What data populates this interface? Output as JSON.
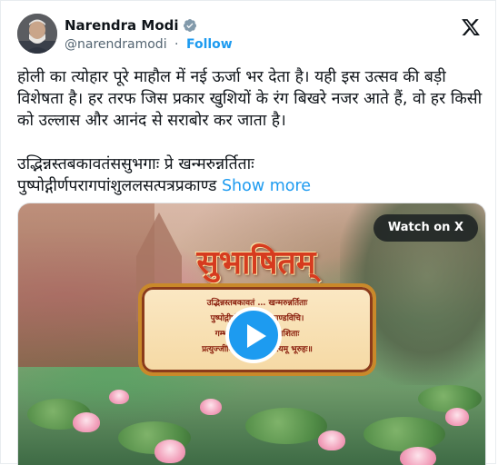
{
  "author": {
    "name": "Narendra Modi",
    "handle": "@narendramodi",
    "separator": "·",
    "follow_label": "Follow"
  },
  "tweet": {
    "text": "होली का त्योहार पूरे माहौल में नई ऊर्जा भर देता है। यही इस उत्सव की बड़ी विशेषता है। हर तरफ जिस प्रकार खुशियों के रंग बिखरे नजर आते हैं, वो हर किसी को उल्लास और आनंद से सराबोर कर जाता है।\n\nउद्भिन्नस्तबकावतंससुभगाः प्रे खन्मरुन्नर्तिताः\nपुष्पोद्गीर्णपरागपांशुललसत्पत्रप्रकाण्ड ",
    "show_more_label": "Show more"
  },
  "media": {
    "watch_label": "Watch on X",
    "title": "सुभाषितम्",
    "verse_lines": [
      "उद्भिन्नस्तबकावतं … खन्मरुन्नर्तिताः",
      "पुष्पोद्गीर्णपराग … प्रकाण्डविचि।",
      "गम्भीरकण्ठ … लोच्छन्नशिताः",
      "प्रत्युज्जीवितमन्म … ज्ञेडन्त्यमू भूरुहः॥"
    ]
  },
  "colors": {
    "accent": "#1d9bf0",
    "text": "#0f1419",
    "muted": "#536471"
  },
  "icons": {
    "verified": "verified-badge-icon",
    "x_logo": "x-logo-icon",
    "play": "play-icon"
  }
}
